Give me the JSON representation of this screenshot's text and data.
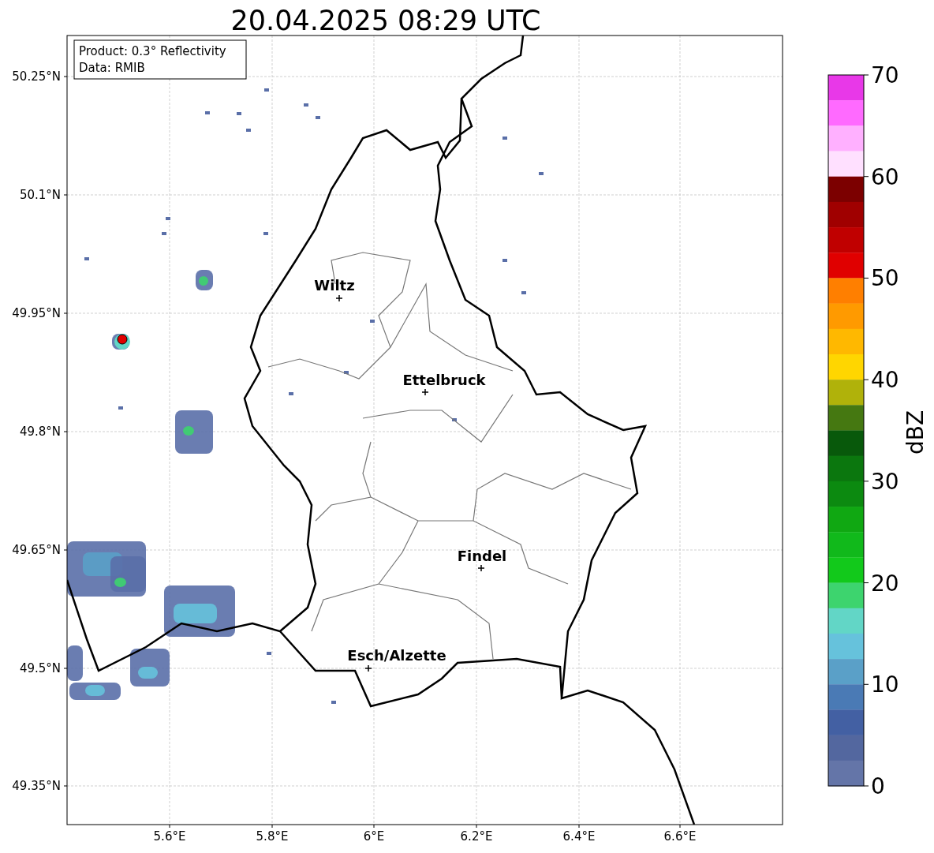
{
  "title": "20.04.2025 08:29 UTC",
  "info_box": {
    "lines": [
      "Product: 0.3° Reflectivity",
      "Data: RMIB"
    ]
  },
  "cities": [
    {
      "name": "Wiltz"
    },
    {
      "name": "Ettelbruck"
    },
    {
      "name": "Findel"
    },
    {
      "name": "Esch/Alzette"
    }
  ],
  "x_ticks": [
    "5.6°E",
    "5.8°E",
    "6°E",
    "6.2°E",
    "6.4°E",
    "6.6°E"
  ],
  "y_ticks": [
    "50.25°N",
    "50.1°N",
    "49.95°N",
    "49.8°N",
    "49.65°N",
    "49.5°N",
    "49.35°N"
  ],
  "colorbar": {
    "label": "dBZ",
    "ticks": [
      "70",
      "60",
      "50",
      "40",
      "30",
      "20",
      "10",
      "0"
    ],
    "bins": [
      {
        "color": "#e838e8"
      },
      {
        "color": "#ff6aff"
      },
      {
        "color": "#ffb0ff"
      },
      {
        "color": "#ffe0ff"
      },
      {
        "color": "#7c0000"
      },
      {
        "color": "#a00000"
      },
      {
        "color": "#c00000"
      },
      {
        "color": "#e00000"
      },
      {
        "color": "#ff7f00"
      },
      {
        "color": "#ff9a00"
      },
      {
        "color": "#ffb800"
      },
      {
        "color": "#ffd600"
      },
      {
        "color": "#b0b20a"
      },
      {
        "color": "#457811"
      },
      {
        "color": "#08590b"
      },
      {
        "color": "#0b770e"
      },
      {
        "color": "#0c8a10"
      },
      {
        "color": "#10a812"
      },
      {
        "color": "#11b91b"
      },
      {
        "color": "#12c91b"
      },
      {
        "color": "#3dd46e"
      },
      {
        "color": "#62d6c6"
      },
      {
        "color": "#66c2dc"
      },
      {
        "color": "#5aa0c8"
      },
      {
        "color": "#4a7ab5"
      },
      {
        "color": "#4360a3"
      },
      {
        "color": "#53679f"
      },
      {
        "color": "#6475a8"
      }
    ]
  }
}
